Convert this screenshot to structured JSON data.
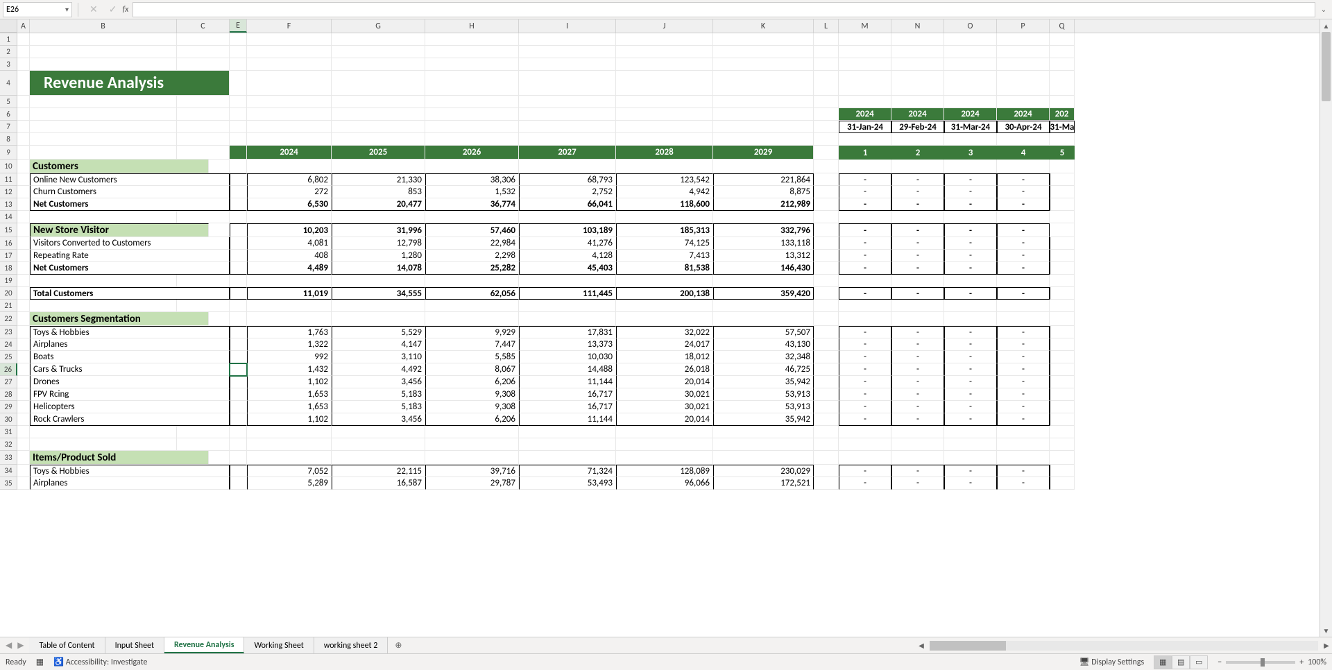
{
  "nameBox": "E26",
  "formula": "",
  "columns": [
    "A",
    "B",
    "C",
    "E",
    "F",
    "G",
    "H",
    "I",
    "J",
    "K",
    "L",
    "M",
    "N",
    "O",
    "P",
    "Q"
  ],
  "colWidths": {
    "A": 18,
    "B": 212,
    "C": 76,
    "E": 25,
    "F": 122,
    "G": 135,
    "H": 135,
    "I": 140,
    "J": 140,
    "K": 145,
    "L": 36,
    "M": 76,
    "N": 76,
    "O": 76,
    "P": 76,
    "Q": 36
  },
  "selectedCol": "E",
  "selectedRow": 26,
  "title": "Revenue Analysis",
  "yearHeaders": [
    "2024",
    "2025",
    "2026",
    "2027",
    "2028",
    "2029"
  ],
  "rightYears": [
    "2024",
    "2024",
    "2024",
    "2024",
    "202"
  ],
  "rightDates": [
    "31-Jan-24",
    "29-Feb-24",
    "31-Mar-24",
    "30-Apr-24",
    "31-Ma"
  ],
  "rightNums": [
    "1",
    "2",
    "3",
    "4",
    "5"
  ],
  "sections": {
    "customers": {
      "label": "Customers",
      "rows": [
        {
          "label": "Online New Customers",
          "vals": [
            "6,802",
            "21,330",
            "38,306",
            "68,793",
            "123,542",
            "221,864"
          ],
          "bold": false,
          "top": true
        },
        {
          "label": "Churn Customers",
          "vals": [
            "272",
            "853",
            "1,532",
            "2,752",
            "4,942",
            "8,875"
          ],
          "bold": false
        },
        {
          "label": "Net Customers",
          "vals": [
            "6,530",
            "20,477",
            "36,774",
            "66,041",
            "118,600",
            "212,989"
          ],
          "bold": true,
          "bottom": true
        }
      ]
    },
    "newStore": {
      "label": "New Store Visitor",
      "headerVals": [
        "10,203",
        "31,996",
        "57,460",
        "103,189",
        "185,313",
        "332,796"
      ],
      "rows": [
        {
          "label": "Visitors Converted to Customers",
          "vals": [
            "4,081",
            "12,798",
            "22,984",
            "41,276",
            "74,125",
            "133,118"
          ]
        },
        {
          "label": "Repeating Rate",
          "vals": [
            "408",
            "1,280",
            "2,298",
            "4,128",
            "7,413",
            "13,312"
          ]
        },
        {
          "label": "Net Customers",
          "vals": [
            "4,489",
            "14,078",
            "25,282",
            "45,403",
            "81,538",
            "146,430"
          ],
          "bold": true,
          "bottom": true
        }
      ]
    },
    "total": {
      "label": "Total Customers",
      "vals": [
        "11,019",
        "34,555",
        "62,056",
        "111,445",
        "200,138",
        "359,420"
      ]
    },
    "segmentation": {
      "label": "Customers Segmentation",
      "rows": [
        {
          "label": "Toys & Hobbies",
          "vals": [
            "1,763",
            "5,529",
            "9,929",
            "17,831",
            "32,022",
            "57,507"
          ],
          "top": true
        },
        {
          "label": "Airplanes",
          "vals": [
            "1,322",
            "4,147",
            "7,447",
            "13,373",
            "24,017",
            "43,130"
          ]
        },
        {
          "label": "Boats",
          "vals": [
            "992",
            "3,110",
            "5,585",
            "10,030",
            "18,012",
            "32,348"
          ]
        },
        {
          "label": "Cars & Trucks",
          "vals": [
            "1,432",
            "4,492",
            "8,067",
            "14,488",
            "26,018",
            "46,725"
          ]
        },
        {
          "label": "Drones",
          "vals": [
            "1,102",
            "3,456",
            "6,206",
            "11,144",
            "20,014",
            "35,942"
          ]
        },
        {
          "label": "FPV Rcing",
          "vals": [
            "1,653",
            "5,183",
            "9,308",
            "16,717",
            "30,021",
            "53,913"
          ]
        },
        {
          "label": "Helicopters",
          "vals": [
            "1,653",
            "5,183",
            "9,308",
            "16,717",
            "30,021",
            "53,913"
          ]
        },
        {
          "label": "Rock Crawlers",
          "vals": [
            "1,102",
            "3,456",
            "6,206",
            "11,144",
            "20,014",
            "35,942"
          ],
          "bottom": true
        }
      ]
    },
    "itemsSold": {
      "label": "Items/Product Sold",
      "rows": [
        {
          "label": "Toys & Hobbies",
          "vals": [
            "7,052",
            "22,115",
            "39,716",
            "71,324",
            "128,089",
            "230,029"
          ],
          "top": true
        },
        {
          "label": "Airplanes",
          "vals": [
            "5,289",
            "16,587",
            "29,787",
            "53,493",
            "96,066",
            "172,521"
          ]
        }
      ]
    }
  },
  "tabs": [
    "Table of Content",
    "Input Sheet",
    "Revenue Analysis",
    "Working Sheet",
    "working sheet 2"
  ],
  "activeTab": "Revenue Analysis",
  "status": {
    "ready": "Ready",
    "accessibility": "Accessibility: Investigate",
    "displaySettings": "Display Settings",
    "zoom": "100%"
  }
}
